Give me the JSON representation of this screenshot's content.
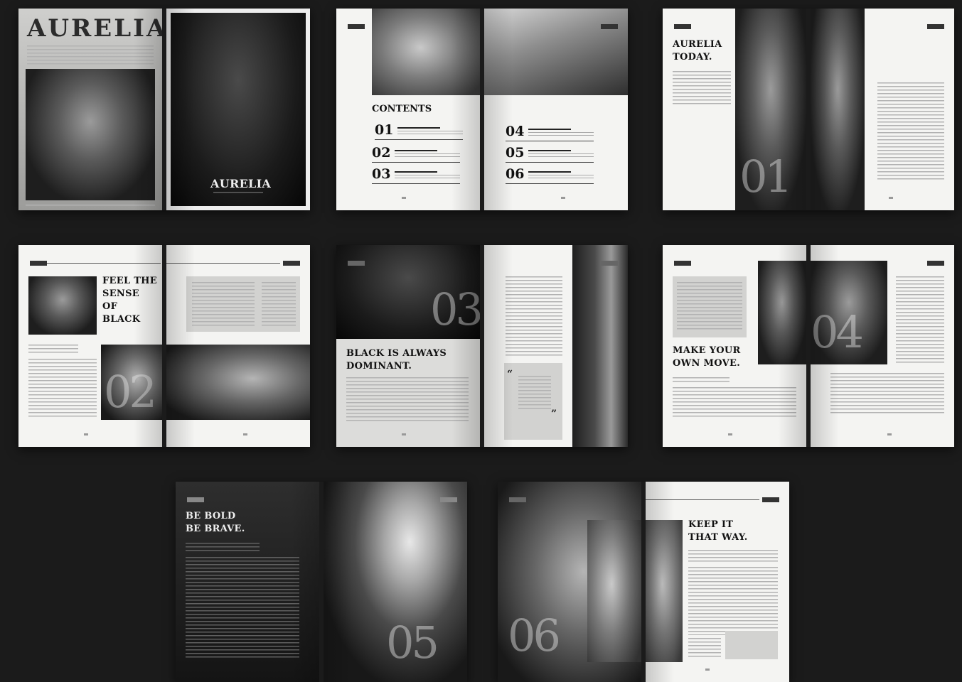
{
  "brand": {
    "cover_title": "AURELIA",
    "cover_logo": "AURELIA"
  },
  "toc": {
    "title": "CONTENTS",
    "items": [
      "01",
      "02",
      "03",
      "04",
      "05",
      "06"
    ]
  },
  "headlines": {
    "aurelia_today": "AURELIA\nTODAY.",
    "feel_the_sense": "FEEL THE\nSENSE\nOF\nBLACK",
    "black_dominant": "BLACK IS ALWAYS\nDOMINANT.",
    "make_your_move": "MAKE YOUR\nOWN MOVE.",
    "be_bold": "BE BOLD\nBE BRAVE.",
    "keep_it": "KEEP IT\nTHAT WAY."
  },
  "chapters": {
    "one": "01",
    "two": "02",
    "three": "03",
    "four": "04",
    "five": "05",
    "six": "06"
  },
  "quote_marks": {
    "open": "“",
    "close": "”"
  }
}
